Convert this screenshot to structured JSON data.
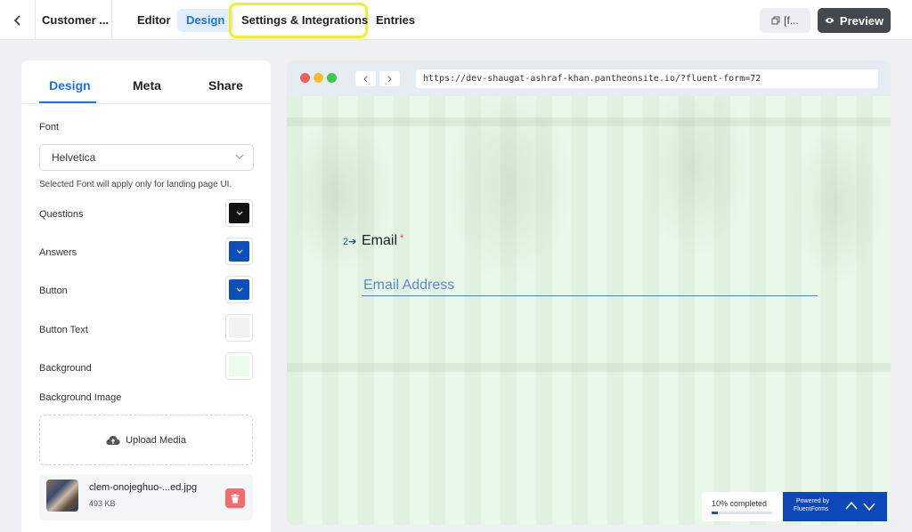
{
  "header": {
    "form_title": "Customer ...",
    "tabs": [
      {
        "label": "Editor"
      },
      {
        "label": "Design"
      },
      {
        "label": "Settings & Integrations"
      },
      {
        "label": "Entries"
      }
    ],
    "shortcode_label": "[f...",
    "preview_label": "Preview"
  },
  "design_panel": {
    "tabs": [
      {
        "label": "Design"
      },
      {
        "label": "Meta"
      },
      {
        "label": "Share"
      }
    ],
    "font_label": "Font",
    "font_value": "Helvetica",
    "font_note": "Selected Font will apply only for landing page UI.",
    "colors": [
      {
        "label": "Questions",
        "color": "#121212"
      },
      {
        "label": "Answers",
        "color": "#0b4fb8"
      },
      {
        "label": "Button",
        "color": "#0b4fb8"
      },
      {
        "label": "Button Text",
        "color": "#f2f2f2"
      },
      {
        "label": "Background",
        "color": "#ebfbec"
      }
    ],
    "background_image_label": "Background Image",
    "upload_label": "Upload Media",
    "media": {
      "filename": "clem-onojeghuo-...ed.jpg",
      "size": "493 KB"
    }
  },
  "preview": {
    "url": "https://dev-shaugat-ashraf-khan.pantheonsite.io/?fluent-form=72",
    "question": {
      "number": "2",
      "label": "Email",
      "required_mark": "*",
      "placeholder": "Email Address"
    },
    "progress": {
      "text": "10% completed",
      "fraction": 0.1
    },
    "powered_line1": "Powered by",
    "powered_line2": "FluentForms"
  }
}
